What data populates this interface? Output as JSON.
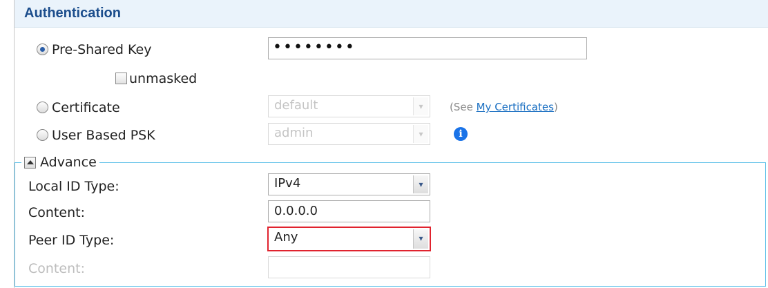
{
  "section": {
    "title": "Authentication"
  },
  "auth": {
    "psk": {
      "label": "Pre-Shared Key",
      "value": "••••••••",
      "selected": true
    },
    "unmasked": {
      "label": "unmasked",
      "checked": false
    },
    "certificate": {
      "label": "Certificate",
      "selected_value": "default",
      "hint_prefix": "(See ",
      "hint_link": "My Certificates",
      "hint_suffix": ")"
    },
    "user_psk": {
      "label": "User Based PSK",
      "selected_value": "admin"
    }
  },
  "advance": {
    "label": "Advance",
    "local_id_type": {
      "label": "Local ID Type:",
      "value": "IPv4"
    },
    "local_content": {
      "label": "Content:",
      "value": "0.0.0.0"
    },
    "peer_id_type": {
      "label": "Peer ID Type:",
      "value": "Any"
    },
    "peer_content": {
      "label": "Content:",
      "value": ""
    }
  },
  "icons": {
    "info": "info-icon",
    "collapse": "collapse-up-icon",
    "dropdown": "chevron-down-icon"
  },
  "colors": {
    "header_text": "#1b4d8c",
    "fieldset_border": "#5bbfe8",
    "highlight": "#e0232e",
    "link": "#1a6fc2",
    "info": "#1a73e8"
  }
}
